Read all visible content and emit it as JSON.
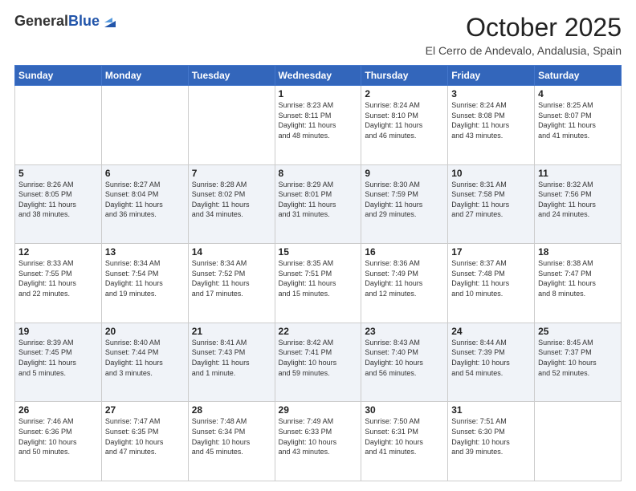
{
  "header": {
    "logo_general": "General",
    "logo_blue": "Blue",
    "month_title": "October 2025",
    "location": "El Cerro de Andevalo, Andalusia, Spain"
  },
  "days_of_week": [
    "Sunday",
    "Monday",
    "Tuesday",
    "Wednesday",
    "Thursday",
    "Friday",
    "Saturday"
  ],
  "weeks": [
    [
      {
        "day": "",
        "info": ""
      },
      {
        "day": "",
        "info": ""
      },
      {
        "day": "",
        "info": ""
      },
      {
        "day": "1",
        "info": "Sunrise: 8:23 AM\nSunset: 8:11 PM\nDaylight: 11 hours\nand 48 minutes."
      },
      {
        "day": "2",
        "info": "Sunrise: 8:24 AM\nSunset: 8:10 PM\nDaylight: 11 hours\nand 46 minutes."
      },
      {
        "day": "3",
        "info": "Sunrise: 8:24 AM\nSunset: 8:08 PM\nDaylight: 11 hours\nand 43 minutes."
      },
      {
        "day": "4",
        "info": "Sunrise: 8:25 AM\nSunset: 8:07 PM\nDaylight: 11 hours\nand 41 minutes."
      }
    ],
    [
      {
        "day": "5",
        "info": "Sunrise: 8:26 AM\nSunset: 8:05 PM\nDaylight: 11 hours\nand 38 minutes."
      },
      {
        "day": "6",
        "info": "Sunrise: 8:27 AM\nSunset: 8:04 PM\nDaylight: 11 hours\nand 36 minutes."
      },
      {
        "day": "7",
        "info": "Sunrise: 8:28 AM\nSunset: 8:02 PM\nDaylight: 11 hours\nand 34 minutes."
      },
      {
        "day": "8",
        "info": "Sunrise: 8:29 AM\nSunset: 8:01 PM\nDaylight: 11 hours\nand 31 minutes."
      },
      {
        "day": "9",
        "info": "Sunrise: 8:30 AM\nSunset: 7:59 PM\nDaylight: 11 hours\nand 29 minutes."
      },
      {
        "day": "10",
        "info": "Sunrise: 8:31 AM\nSunset: 7:58 PM\nDaylight: 11 hours\nand 27 minutes."
      },
      {
        "day": "11",
        "info": "Sunrise: 8:32 AM\nSunset: 7:56 PM\nDaylight: 11 hours\nand 24 minutes."
      }
    ],
    [
      {
        "day": "12",
        "info": "Sunrise: 8:33 AM\nSunset: 7:55 PM\nDaylight: 11 hours\nand 22 minutes."
      },
      {
        "day": "13",
        "info": "Sunrise: 8:34 AM\nSunset: 7:54 PM\nDaylight: 11 hours\nand 19 minutes."
      },
      {
        "day": "14",
        "info": "Sunrise: 8:34 AM\nSunset: 7:52 PM\nDaylight: 11 hours\nand 17 minutes."
      },
      {
        "day": "15",
        "info": "Sunrise: 8:35 AM\nSunset: 7:51 PM\nDaylight: 11 hours\nand 15 minutes."
      },
      {
        "day": "16",
        "info": "Sunrise: 8:36 AM\nSunset: 7:49 PM\nDaylight: 11 hours\nand 12 minutes."
      },
      {
        "day": "17",
        "info": "Sunrise: 8:37 AM\nSunset: 7:48 PM\nDaylight: 11 hours\nand 10 minutes."
      },
      {
        "day": "18",
        "info": "Sunrise: 8:38 AM\nSunset: 7:47 PM\nDaylight: 11 hours\nand 8 minutes."
      }
    ],
    [
      {
        "day": "19",
        "info": "Sunrise: 8:39 AM\nSunset: 7:45 PM\nDaylight: 11 hours\nand 5 minutes."
      },
      {
        "day": "20",
        "info": "Sunrise: 8:40 AM\nSunset: 7:44 PM\nDaylight: 11 hours\nand 3 minutes."
      },
      {
        "day": "21",
        "info": "Sunrise: 8:41 AM\nSunset: 7:43 PM\nDaylight: 11 hours\nand 1 minute."
      },
      {
        "day": "22",
        "info": "Sunrise: 8:42 AM\nSunset: 7:41 PM\nDaylight: 10 hours\nand 59 minutes."
      },
      {
        "day": "23",
        "info": "Sunrise: 8:43 AM\nSunset: 7:40 PM\nDaylight: 10 hours\nand 56 minutes."
      },
      {
        "day": "24",
        "info": "Sunrise: 8:44 AM\nSunset: 7:39 PM\nDaylight: 10 hours\nand 54 minutes."
      },
      {
        "day": "25",
        "info": "Sunrise: 8:45 AM\nSunset: 7:37 PM\nDaylight: 10 hours\nand 52 minutes."
      }
    ],
    [
      {
        "day": "26",
        "info": "Sunrise: 7:46 AM\nSunset: 6:36 PM\nDaylight: 10 hours\nand 50 minutes."
      },
      {
        "day": "27",
        "info": "Sunrise: 7:47 AM\nSunset: 6:35 PM\nDaylight: 10 hours\nand 47 minutes."
      },
      {
        "day": "28",
        "info": "Sunrise: 7:48 AM\nSunset: 6:34 PM\nDaylight: 10 hours\nand 45 minutes."
      },
      {
        "day": "29",
        "info": "Sunrise: 7:49 AM\nSunset: 6:33 PM\nDaylight: 10 hours\nand 43 minutes."
      },
      {
        "day": "30",
        "info": "Sunrise: 7:50 AM\nSunset: 6:31 PM\nDaylight: 10 hours\nand 41 minutes."
      },
      {
        "day": "31",
        "info": "Sunrise: 7:51 AM\nSunset: 6:30 PM\nDaylight: 10 hours\nand 39 minutes."
      },
      {
        "day": "",
        "info": ""
      }
    ]
  ]
}
